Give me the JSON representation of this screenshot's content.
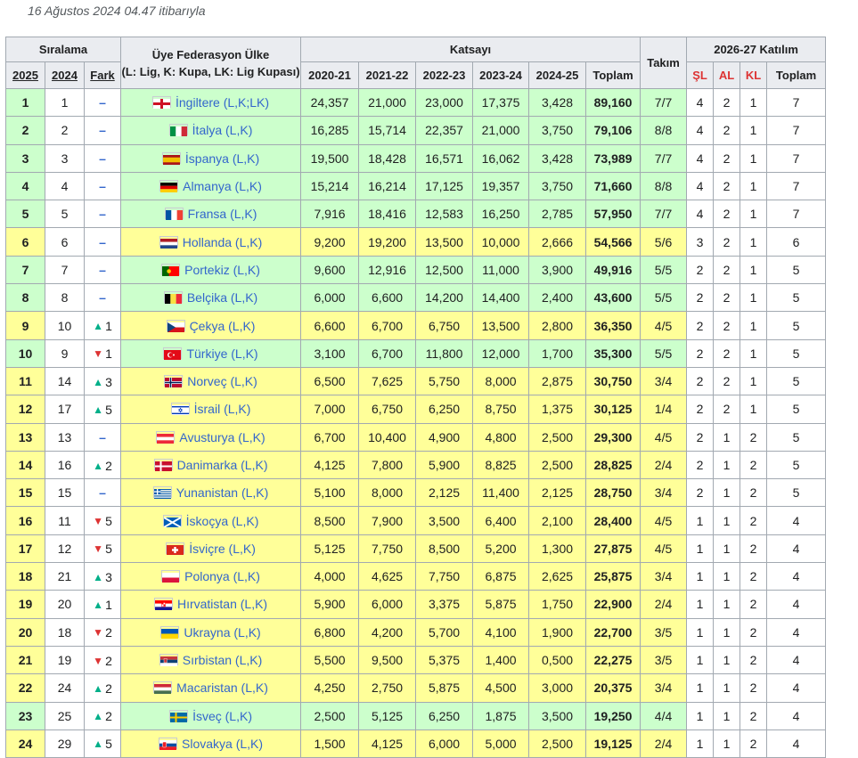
{
  "as_of": "16 Ağustos 2024 04.47 itibarıyla",
  "headers": {
    "siralama": "Sıralama",
    "uye": "Üye Federasyon Ülke",
    "uye_note": "(L: Lig, K: Kupa, LK: Lig Kupası)",
    "katsayi": "Katsayı",
    "takim": "Takım",
    "katilim": "2026-27 Katılım",
    "y2025": "2025",
    "y2024": "2024",
    "fark": "Fark",
    "s1": "2020-21",
    "s2": "2021-22",
    "s3": "2022-23",
    "s4": "2023-24",
    "s5": "2024-25",
    "toplam": "Toplam",
    "sl": "ŞL",
    "al": "AL",
    "kl": "KL",
    "toplam2": "Toplam"
  },
  "colors": {
    "green": "#ccffcc",
    "yellow": "#ffff99",
    "up": "#00af89",
    "down": "#d33333",
    "same": "#3366cc"
  },
  "rows": [
    {
      "r2025": "1",
      "r2024": "1",
      "chg": "same",
      "chg_val": "",
      "country": "İngiltere (L,K;LK)",
      "flag": "eng",
      "c": [
        "24,357",
        "21,000",
        "23,000",
        "17,375",
        "3,428"
      ],
      "total": "89,160",
      "takim": "7/7",
      "sl": "4",
      "al": "2",
      "kl": "1",
      "tot": "7",
      "color": "g"
    },
    {
      "r2025": "2",
      "r2024": "2",
      "chg": "same",
      "chg_val": "",
      "country": "İtalya (L,K)",
      "flag": "ita",
      "c": [
        "16,285",
        "15,714",
        "22,357",
        "21,000",
        "3,750"
      ],
      "total": "79,106",
      "takim": "8/8",
      "sl": "4",
      "al": "2",
      "kl": "1",
      "tot": "7",
      "color": "g"
    },
    {
      "r2025": "3",
      "r2024": "3",
      "chg": "same",
      "chg_val": "",
      "country": "İspanya (L,K)",
      "flag": "esp",
      "c": [
        "19,500",
        "18,428",
        "16,571",
        "16,062",
        "3,428"
      ],
      "total": "73,989",
      "takim": "7/7",
      "sl": "4",
      "al": "2",
      "kl": "1",
      "tot": "7",
      "color": "g"
    },
    {
      "r2025": "4",
      "r2024": "4",
      "chg": "same",
      "chg_val": "",
      "country": "Almanya (L,K)",
      "flag": "ger",
      "c": [
        "15,214",
        "16,214",
        "17,125",
        "19,357",
        "3,750"
      ],
      "total": "71,660",
      "takim": "8/8",
      "sl": "4",
      "al": "2",
      "kl": "1",
      "tot": "7",
      "color": "g"
    },
    {
      "r2025": "5",
      "r2024": "5",
      "chg": "same",
      "chg_val": "",
      "country": "Fransa (L,K)",
      "flag": "fra",
      "c": [
        "7,916",
        "18,416",
        "12,583",
        "16,250",
        "2,785"
      ],
      "total": "57,950",
      "takim": "7/7",
      "sl": "4",
      "al": "2",
      "kl": "1",
      "tot": "7",
      "color": "g"
    },
    {
      "r2025": "6",
      "r2024": "6",
      "chg": "same",
      "chg_val": "",
      "country": "Hollanda (L,K)",
      "flag": "ned",
      "c": [
        "9,200",
        "19,200",
        "13,500",
        "10,000",
        "2,666"
      ],
      "total": "54,566",
      "takim": "5/6",
      "sl": "3",
      "al": "2",
      "kl": "1",
      "tot": "6",
      "color": "y"
    },
    {
      "r2025": "7",
      "r2024": "7",
      "chg": "same",
      "chg_val": "",
      "country": "Portekiz (L,K)",
      "flag": "por",
      "c": [
        "9,600",
        "12,916",
        "12,500",
        "11,000",
        "3,900"
      ],
      "total": "49,916",
      "takim": "5/5",
      "sl": "2",
      "al": "2",
      "kl": "1",
      "tot": "5",
      "color": "g"
    },
    {
      "r2025": "8",
      "r2024": "8",
      "chg": "same",
      "chg_val": "",
      "country": "Belçika (L,K)",
      "flag": "bel",
      "c": [
        "6,000",
        "6,600",
        "14,200",
        "14,400",
        "2,400"
      ],
      "total": "43,600",
      "takim": "5/5",
      "sl": "2",
      "al": "2",
      "kl": "1",
      "tot": "5",
      "color": "g"
    },
    {
      "r2025": "9",
      "r2024": "10",
      "chg": "up",
      "chg_val": "1",
      "country": "Çekya (L,K)",
      "flag": "cze",
      "c": [
        "6,600",
        "6,700",
        "6,750",
        "13,500",
        "2,800"
      ],
      "total": "36,350",
      "takim": "4/5",
      "sl": "2",
      "al": "2",
      "kl": "1",
      "tot": "5",
      "color": "y"
    },
    {
      "r2025": "10",
      "r2024": "9",
      "chg": "down",
      "chg_val": "1",
      "country": "Türkiye (L,K)",
      "flag": "tur",
      "c": [
        "3,100",
        "6,700",
        "11,800",
        "12,000",
        "1,700"
      ],
      "total": "35,300",
      "takim": "5/5",
      "sl": "2",
      "al": "2",
      "kl": "1",
      "tot": "5",
      "color": "g"
    },
    {
      "r2025": "11",
      "r2024": "14",
      "chg": "up",
      "chg_val": "3",
      "country": "Norveç (L,K)",
      "flag": "nor",
      "c": [
        "6,500",
        "7,625",
        "5,750",
        "8,000",
        "2,875"
      ],
      "total": "30,750",
      "takim": "3/4",
      "sl": "2",
      "al": "2",
      "kl": "1",
      "tot": "5",
      "color": "y"
    },
    {
      "r2025": "12",
      "r2024": "17",
      "chg": "up",
      "chg_val": "5",
      "country": "İsrail (L,K)",
      "flag": "isr",
      "c": [
        "7,000",
        "6,750",
        "6,250",
        "8,750",
        "1,375"
      ],
      "total": "30,125",
      "takim": "1/4",
      "sl": "2",
      "al": "2",
      "kl": "1",
      "tot": "5",
      "color": "y"
    },
    {
      "r2025": "13",
      "r2024": "13",
      "chg": "same",
      "chg_val": "",
      "country": "Avusturya (L,K)",
      "flag": "aut",
      "c": [
        "6,700",
        "10,400",
        "4,900",
        "4,800",
        "2,500"
      ],
      "total": "29,300",
      "takim": "4/5",
      "sl": "2",
      "al": "1",
      "kl": "2",
      "tot": "5",
      "color": "y"
    },
    {
      "r2025": "14",
      "r2024": "16",
      "chg": "up",
      "chg_val": "2",
      "country": "Danimarka (L,K)",
      "flag": "den",
      "c": [
        "4,125",
        "7,800",
        "5,900",
        "8,825",
        "2,500"
      ],
      "total": "28,825",
      "takim": "2/4",
      "sl": "2",
      "al": "1",
      "kl": "2",
      "tot": "5",
      "color": "y"
    },
    {
      "r2025": "15",
      "r2024": "15",
      "chg": "same",
      "chg_val": "",
      "country": "Yunanistan (L,K)",
      "flag": "gre",
      "c": [
        "5,100",
        "8,000",
        "2,125",
        "11,400",
        "2,125"
      ],
      "total": "28,750",
      "takim": "3/4",
      "sl": "2",
      "al": "1",
      "kl": "2",
      "tot": "5",
      "color": "y"
    },
    {
      "r2025": "16",
      "r2024": "11",
      "chg": "down",
      "chg_val": "5",
      "country": "İskoçya (L,K)",
      "flag": "sco",
      "c": [
        "8,500",
        "7,900",
        "3,500",
        "6,400",
        "2,100"
      ],
      "total": "28,400",
      "takim": "4/5",
      "sl": "1",
      "al": "1",
      "kl": "2",
      "tot": "4",
      "color": "y"
    },
    {
      "r2025": "17",
      "r2024": "12",
      "chg": "down",
      "chg_val": "5",
      "country": "İsviçre (L,K)",
      "flag": "sui",
      "c": [
        "5,125",
        "7,750",
        "8,500",
        "5,200",
        "1,300"
      ],
      "total": "27,875",
      "takim": "4/5",
      "sl": "1",
      "al": "1",
      "kl": "2",
      "tot": "4",
      "color": "y"
    },
    {
      "r2025": "18",
      "r2024": "21",
      "chg": "up",
      "chg_val": "3",
      "country": "Polonya (L,K)",
      "flag": "pol",
      "c": [
        "4,000",
        "4,625",
        "7,750",
        "6,875",
        "2,625"
      ],
      "total": "25,875",
      "takim": "3/4",
      "sl": "1",
      "al": "1",
      "kl": "2",
      "tot": "4",
      "color": "y"
    },
    {
      "r2025": "19",
      "r2024": "20",
      "chg": "up",
      "chg_val": "1",
      "country": "Hırvatistan (L,K)",
      "flag": "cro",
      "c": [
        "5,900",
        "6,000",
        "3,375",
        "5,875",
        "1,750"
      ],
      "total": "22,900",
      "takim": "2/4",
      "sl": "1",
      "al": "1",
      "kl": "2",
      "tot": "4",
      "color": "y"
    },
    {
      "r2025": "20",
      "r2024": "18",
      "chg": "down",
      "chg_val": "2",
      "country": "Ukrayna (L,K)",
      "flag": "ukr",
      "c": [
        "6,800",
        "4,200",
        "5,700",
        "4,100",
        "1,900"
      ],
      "total": "22,700",
      "takim": "3/5",
      "sl": "1",
      "al": "1",
      "kl": "2",
      "tot": "4",
      "color": "y"
    },
    {
      "r2025": "21",
      "r2024": "19",
      "chg": "down",
      "chg_val": "2",
      "country": "Sırbistan (L,K)",
      "flag": "srb",
      "c": [
        "5,500",
        "9,500",
        "5,375",
        "1,400",
        "0,500"
      ],
      "total": "22,275",
      "takim": "3/5",
      "sl": "1",
      "al": "1",
      "kl": "2",
      "tot": "4",
      "color": "y"
    },
    {
      "r2025": "22",
      "r2024": "24",
      "chg": "up",
      "chg_val": "2",
      "country": "Macaristan (L,K)",
      "flag": "hun",
      "c": [
        "4,250",
        "2,750",
        "5,875",
        "4,500",
        "3,000"
      ],
      "total": "20,375",
      "takim": "3/4",
      "sl": "1",
      "al": "1",
      "kl": "2",
      "tot": "4",
      "color": "y"
    },
    {
      "r2025": "23",
      "r2024": "25",
      "chg": "up",
      "chg_val": "2",
      "country": "İsveç (L,K)",
      "flag": "swe",
      "c": [
        "2,500",
        "5,125",
        "6,250",
        "1,875",
        "3,500"
      ],
      "total": "19,250",
      "takim": "4/4",
      "sl": "1",
      "al": "1",
      "kl": "2",
      "tot": "4",
      "color": "g"
    },
    {
      "r2025": "24",
      "r2024": "29",
      "chg": "up",
      "chg_val": "5",
      "country": "Slovakya (L,K)",
      "flag": "svk",
      "c": [
        "1,500",
        "4,125",
        "6,000",
        "5,000",
        "2,500"
      ],
      "total": "19,125",
      "takim": "2/4",
      "sl": "1",
      "al": "1",
      "kl": "2",
      "tot": "4",
      "color": "y"
    }
  ]
}
